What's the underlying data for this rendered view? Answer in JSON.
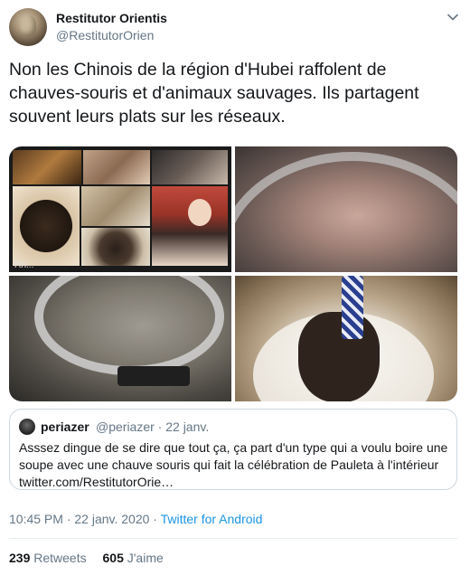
{
  "author": {
    "display_name": "Restitutor Orientis",
    "handle": "@RestitutorOrien"
  },
  "tweet": {
    "text": "Non les Chinois de la région d'Hubei raffolent de chauves-souris et d'animaux sauvages. Ils partagent souvent leurs plats sur les réseaux."
  },
  "media": {
    "tile1_caption": "Пл..."
  },
  "quoted_tweet": {
    "display_name": "periazer",
    "handle_date": "@periazer · 22 janv.",
    "text": "Asssez dingue de se dire que tout ça, ça part d'un type qui a voulu boire une soupe avec une chauve souris qui fait la célébration de Pauleta à l'intérieur twitter.com/RestitutorOrie…"
  },
  "meta": {
    "timestamp": "10:45 PM · 22 janv. 2020 · ",
    "source": "Twitter for Android"
  },
  "stats": {
    "retweets_count": "239",
    "retweets_label": "Retweets",
    "likes_count": "605",
    "likes_label": "J'aime"
  },
  "icons": {
    "caret": "chevron-down-icon"
  }
}
